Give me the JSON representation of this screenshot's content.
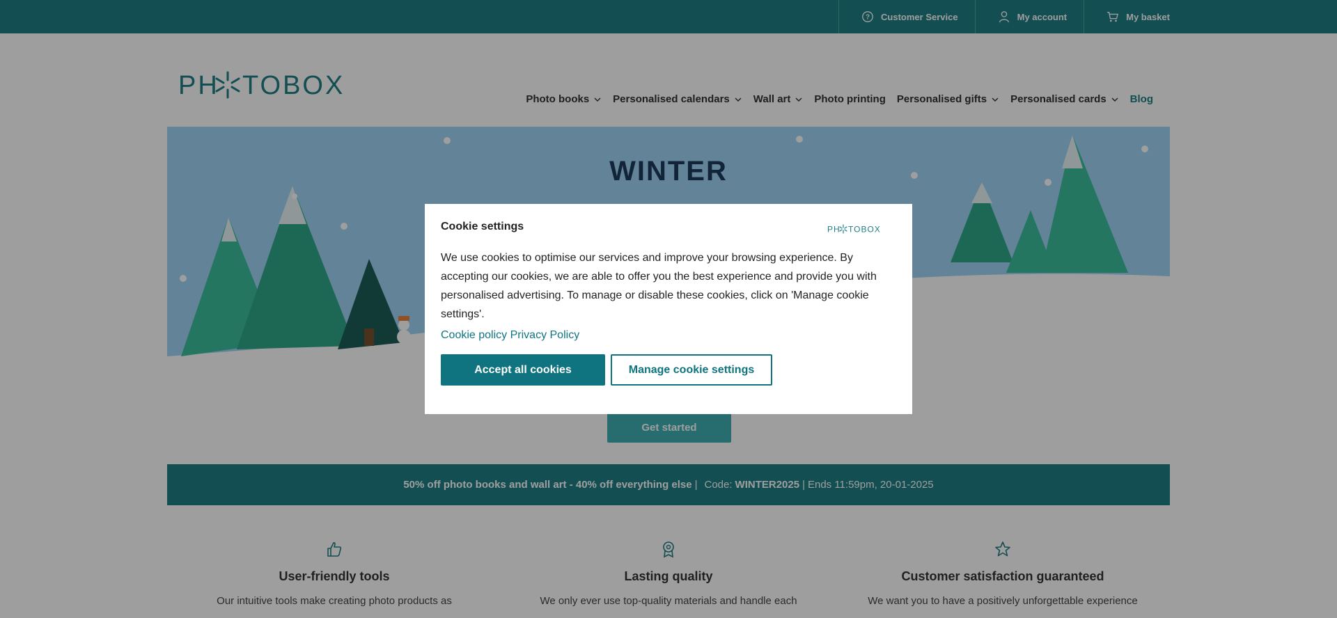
{
  "topbar": {
    "customer_service": "Customer Service",
    "account": "My account",
    "basket": "My basket"
  },
  "header": {
    "logo_text": "PHOTOBOX",
    "nav": [
      {
        "label": "Photo books",
        "dropdown": true
      },
      {
        "label": "Personalised calendars",
        "dropdown": true
      },
      {
        "label": "Wall art",
        "dropdown": true
      },
      {
        "label": "Photo printing",
        "dropdown": false
      },
      {
        "label": "Personalised gifts",
        "dropdown": true
      },
      {
        "label": "Personalised cards",
        "dropdown": true
      },
      {
        "label": "Blog",
        "dropdown": false
      }
    ]
  },
  "hero": {
    "title": "WINTER",
    "button": "Get started"
  },
  "promo": {
    "offer": "50% off photo books and wall art - 40% off everything else",
    "sep1": "|",
    "code_label": "Code:",
    "code": "WINTER2025",
    "sep2": "|",
    "ends": "Ends 11:59pm, 20-01-2025"
  },
  "features": [
    {
      "icon": "thumbs-up-icon",
      "title": "User-friendly tools",
      "text": "Our intuitive tools make creating photo products as"
    },
    {
      "icon": "award-icon",
      "title": "Lasting quality",
      "text": "We only ever use top-quality materials and handle each"
    },
    {
      "icon": "star-icon",
      "title": "Customer satisfaction guaranteed",
      "text": "We want you to have a positively unforgettable experience"
    }
  ],
  "cookie": {
    "title": "Cookie settings",
    "logo_text": "PHOTOBOX",
    "body": "We use cookies to optimise our services and improve your browsing experience. By accepting our cookies, we are able to offer you the best experience and provide you with personalised advertising. To manage or disable these cookies, click on 'Manage cookie settings'.",
    "link_cookie_policy": "Cookie policy",
    "link_privacy": "Privacy Policy",
    "accept": "Accept all cookies",
    "manage": "Manage cookie settings"
  },
  "colors": {
    "brand_teal": "#1f7e85",
    "dialog_teal": "#0f7480",
    "sale_red": "#e23a3a"
  }
}
